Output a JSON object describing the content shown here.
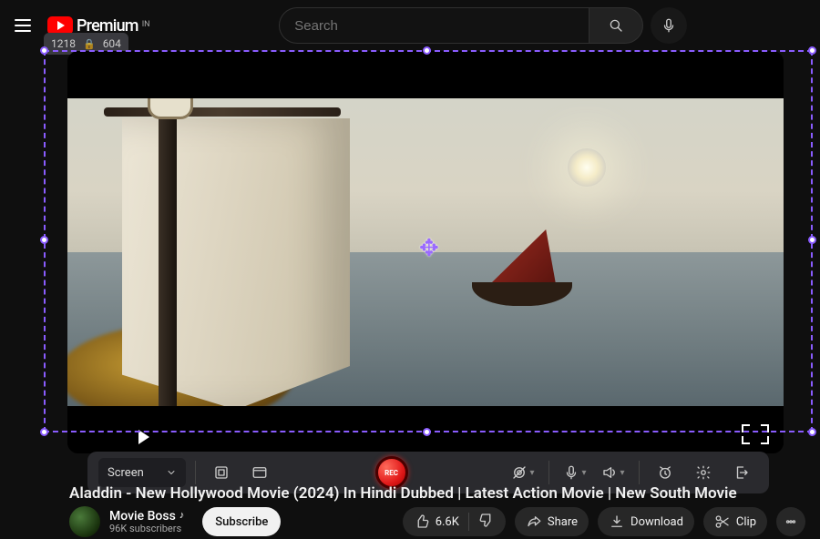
{
  "header": {
    "brand": "Premium",
    "region": "IN",
    "search_placeholder": "Search"
  },
  "selection": {
    "width": "1218",
    "height": "604"
  },
  "recorder": {
    "source_label": "Screen",
    "rec_label": "REC"
  },
  "video": {
    "title": "Aladdin - New Hollywood Movie (2024) In Hindi Dubbed | Latest Action Movie | New South Movie",
    "channel_name": "Movie Boss",
    "subscribers": "96K subscribers",
    "subscribe_label": "Subscribe",
    "likes": "6.6K",
    "share_label": "Share",
    "download_label": "Download",
    "clip_label": "Clip"
  }
}
